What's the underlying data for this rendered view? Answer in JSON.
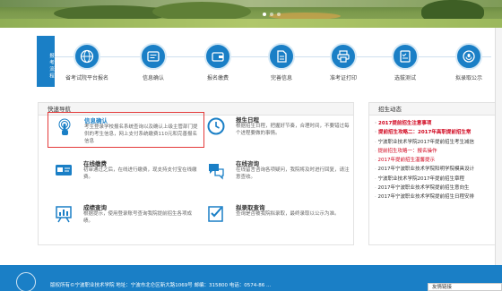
{
  "process": {
    "label": "报考流程",
    "steps": [
      {
        "label": "省考试院平台报名",
        "icon": "globe-icon"
      },
      {
        "label": "信息确认",
        "icon": "info-icon"
      },
      {
        "label": "报名缴费",
        "icon": "wallet-icon"
      },
      {
        "label": "完善信息",
        "icon": "document-icon"
      },
      {
        "label": "准考证打印",
        "icon": "printer-icon"
      },
      {
        "label": "选拔测试",
        "icon": "test-icon"
      },
      {
        "label": "拟录取公示",
        "icon": "announcement-icon"
      }
    ]
  },
  "quick_nav": {
    "title": "快速导航",
    "cards": [
      {
        "title": "信息确认",
        "desc": "考生登录学校报名系统查询以及确认上级主管部门提供的考生信息，网上支付系统缴费110元和完善报名信息",
        "icon": "touch-hand-icon"
      },
      {
        "title": "报生日程",
        "desc": "根据招生日程，把握好节奏，合理时间，不要错过每个进程要做的事情。",
        "icon": "clock-icon"
      },
      {
        "title": "在线缴费",
        "desc": "初审通过之后，在线进行缴费，现支持支付宝在线缴费。",
        "icon": "payment-card-icon"
      },
      {
        "title": "在线咨询",
        "desc": "在线留言咨询各项疑问，我院将及时进行回复，请注意查收。",
        "icon": "chat-icon"
      },
      {
        "title": "成绩查询",
        "desc": "根据提示，使用登录账号查询我院提前招生各项成绩。",
        "icon": "score-board-icon"
      },
      {
        "title": "拟录取查询",
        "desc": "查询是否被我院拟录取，最终录取以公示为准。",
        "icon": "checklist-icon"
      }
    ]
  },
  "news": {
    "title": "招生动态",
    "items": [
      {
        "text": "2017提前招生注意事项",
        "style": "red bold"
      },
      {
        "text": "提前招生攻略二：2017年高职提前招生常",
        "style": "red bold"
      },
      {
        "text": "宁波职业技术学院2017年提前招生考生减信",
        "style": ""
      },
      {
        "text": "提前招生攻略一：报名操作",
        "style": "red"
      },
      {
        "text": "2017年提前招生温馨提示",
        "style": "red"
      },
      {
        "text": "2017年宁波职业技术学院阳明学院模具设计",
        "style": ""
      },
      {
        "text": "宁波职业技术学院2017年提前招生章程",
        "style": ""
      },
      {
        "text": "2017年宁波职业技术学院提前招生意向生",
        "style": ""
      },
      {
        "text": "2017年宁波职业技术学院提前招生日程安排",
        "style": ""
      }
    ]
  },
  "footer": {
    "text": "版权所有©宁波职业技术学院   地址：宁波市北仑区新大路1069号   邮编：315800   电话：0574-86 ...",
    "corner": "友情链接"
  },
  "colors": {
    "brand": "#1a7fc6",
    "highlight": "#e43a3a",
    "news_red": "#d0021b"
  }
}
